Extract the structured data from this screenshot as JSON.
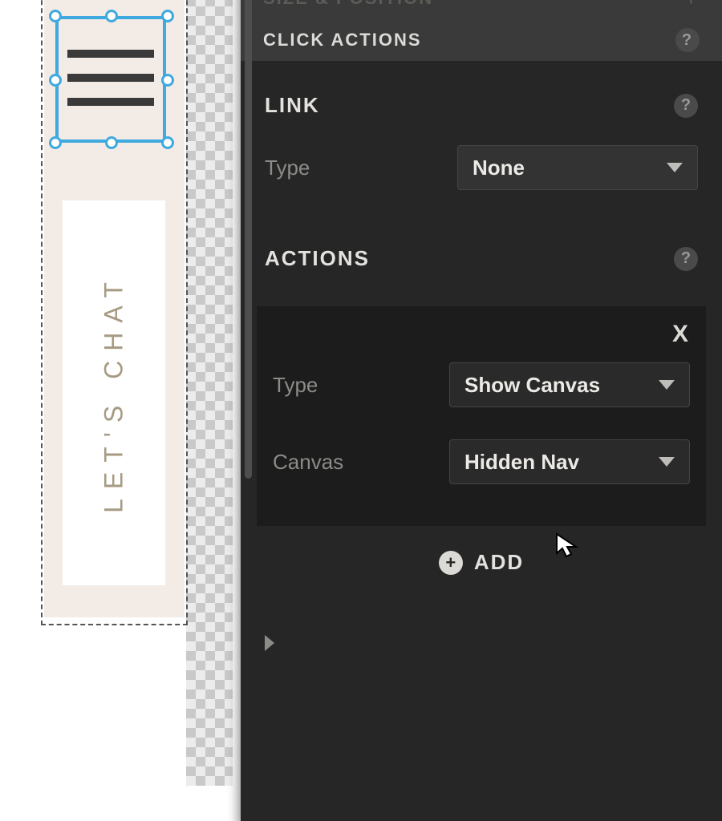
{
  "canvas": {
    "selected_element": "hamburger-icon",
    "chat_label": "LET'S CHAT"
  },
  "panel": {
    "sections": {
      "size_position": {
        "title": "SIZE & POSITION"
      },
      "click_actions": {
        "title": "CLICK ACTIONS"
      }
    },
    "link": {
      "heading": "LINK",
      "type_label": "Type",
      "type_value": "None"
    },
    "actions": {
      "heading": "ACTIONS",
      "item": {
        "type_label": "Type",
        "type_value": "Show Canvas",
        "canvas_label": "Canvas",
        "canvas_value": "Hidden Nav"
      },
      "add_label": "ADD"
    }
  }
}
